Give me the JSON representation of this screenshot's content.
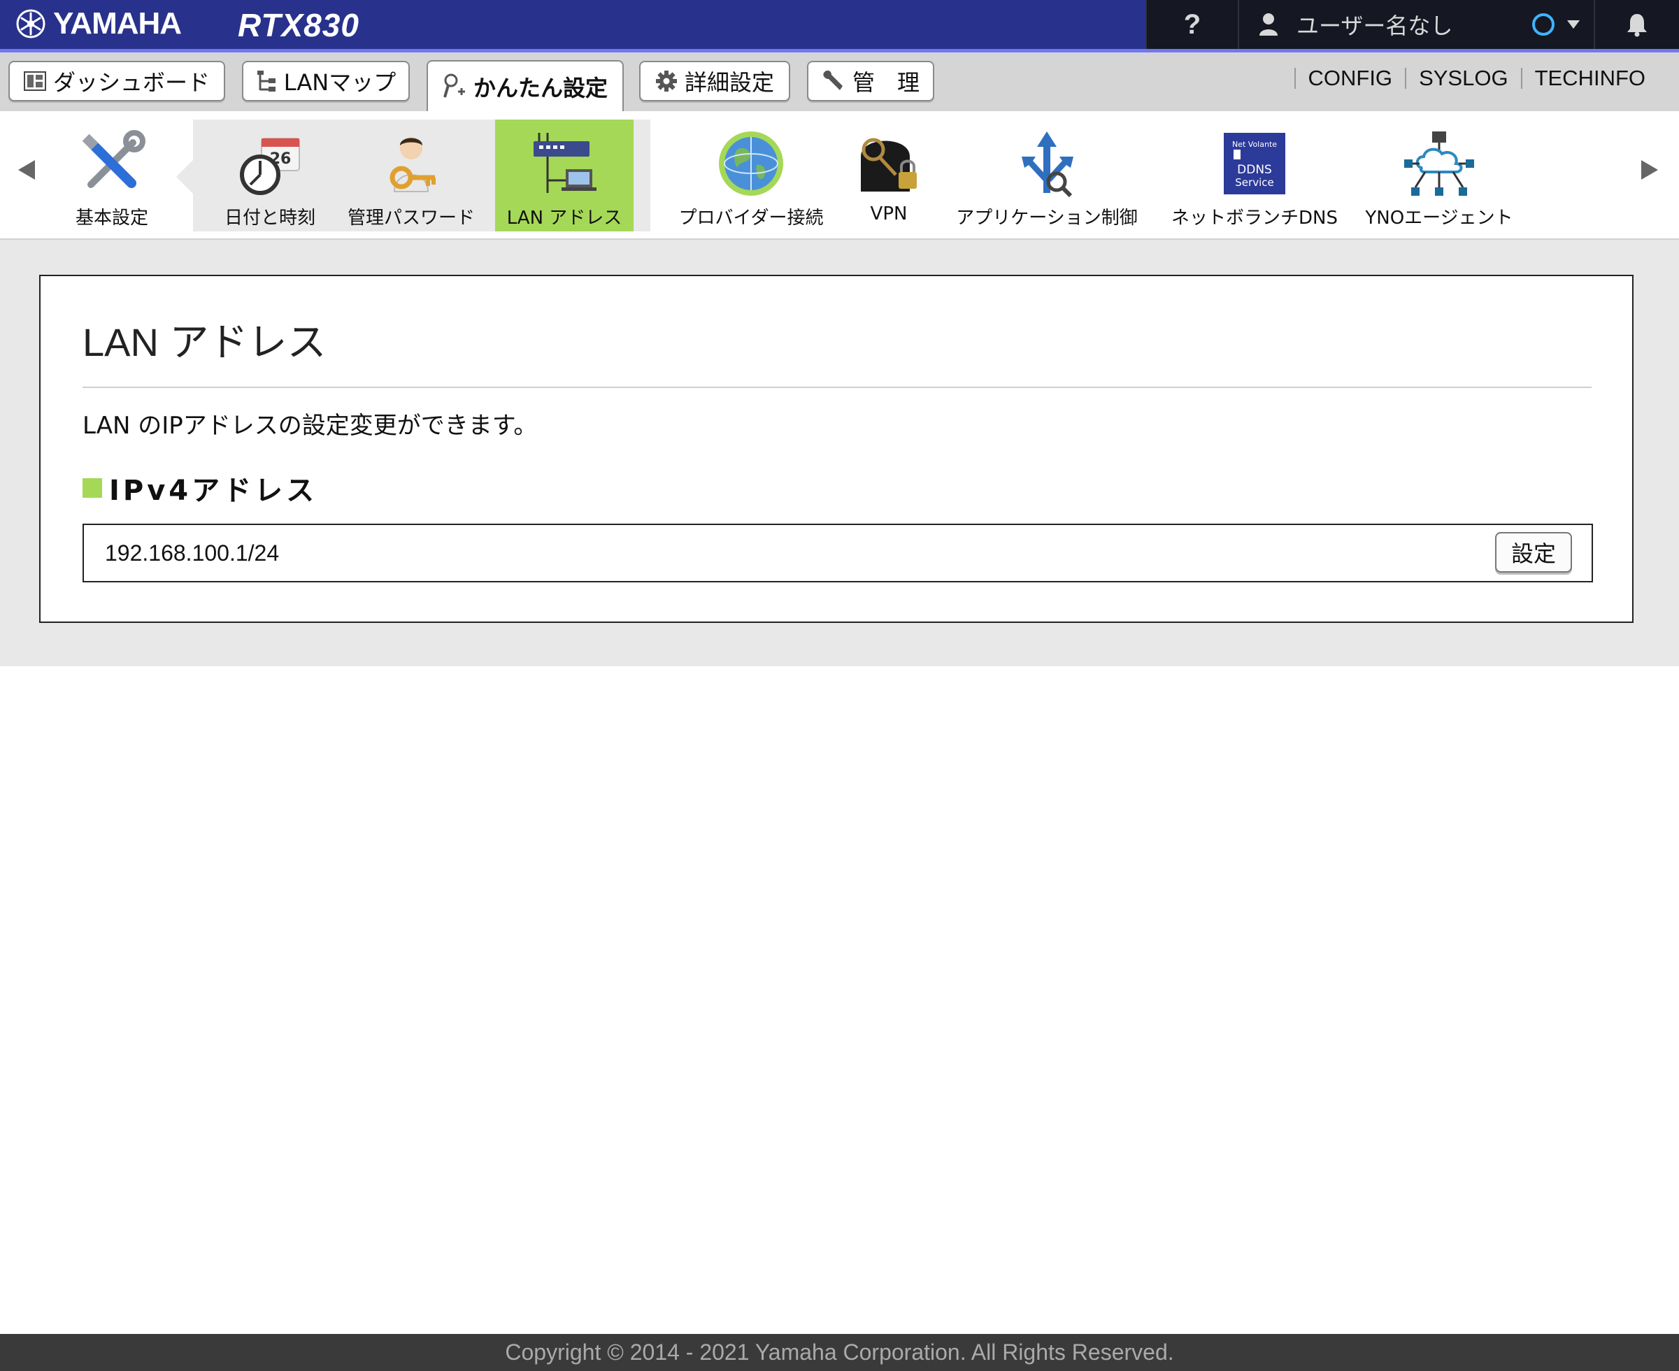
{
  "header": {
    "brand": "YAMAHA",
    "model": "RTX830",
    "help_label": "?",
    "user_label": "ユーザー名なし"
  },
  "tabs": [
    {
      "label": "ダッシュボード",
      "icon": "dashboard-icon"
    },
    {
      "label": "LANマップ",
      "icon": "lan-map-icon"
    },
    {
      "label": "かんたん設定",
      "icon": "easy-setup-icon",
      "active": true
    },
    {
      "label": "詳細設定",
      "icon": "gear-icon"
    },
    {
      "label": "管　理",
      "icon": "wrench-icon"
    }
  ],
  "top_links": [
    "CONFIG",
    "SYSLOG",
    "TECHINFO"
  ],
  "icon_menu": [
    {
      "label": "基本設定",
      "icon": "tools-icon"
    },
    {
      "label": "日付と時刻",
      "icon": "calendar-clock-icon"
    },
    {
      "label": "管理パスワード",
      "icon": "admin-key-icon"
    },
    {
      "label": "LAN アドレス",
      "icon": "lan-router-icon",
      "active": true
    },
    {
      "label": "プロバイダー接続",
      "icon": "globe-icon"
    },
    {
      "label": "VPN",
      "icon": "vpn-lock-icon"
    },
    {
      "label": "アプリケーション制御",
      "icon": "app-control-icon"
    },
    {
      "label": "ネットボランチDNS",
      "icon": "ddns-service-icon"
    },
    {
      "label": "YNOエージェント",
      "icon": "network-cloud-icon"
    }
  ],
  "ddns_icon_text": {
    "line1": "DDNS",
    "line2": "Service",
    "top": "Net Volante"
  },
  "calendar_day": "26",
  "main": {
    "title": "LAN アドレス",
    "description": "LAN のIPアドレスの設定変更ができます。",
    "section_title": "IPv4アドレス",
    "ipv4_value": "192.168.100.1/24",
    "set_button": "設定"
  },
  "footer": {
    "copyright": "Copyright © 2014 - 2021 Yamaha Corporation. All Rights Reserved."
  },
  "colors": {
    "header_bg": "#28328c",
    "accent_green": "#a5d857",
    "header_dark": "#151722",
    "footer_bg": "#3a3a3a"
  }
}
